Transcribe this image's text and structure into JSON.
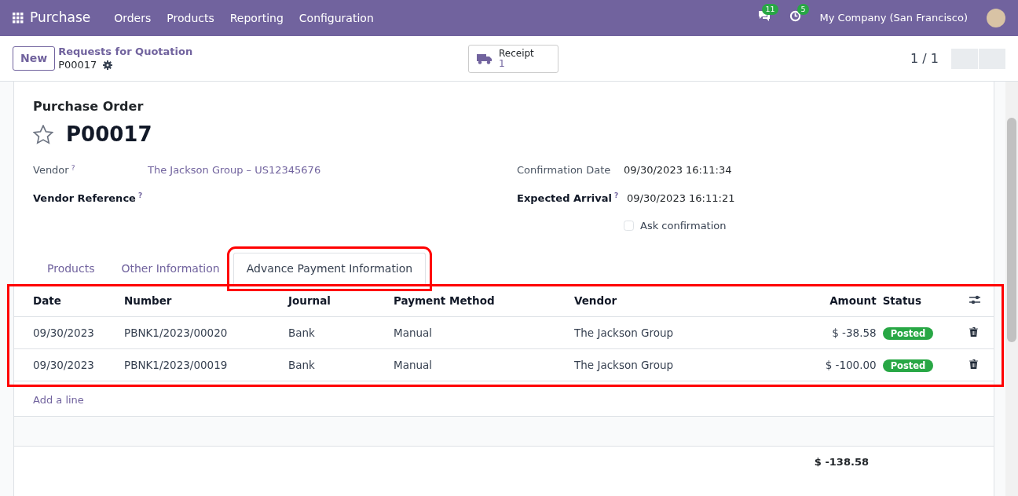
{
  "navbar": {
    "app": "Purchase",
    "menu": [
      "Orders",
      "Products",
      "Reporting",
      "Configuration"
    ],
    "messages_count": "11",
    "activities_count": "5",
    "company": "My Company (San Francisco)"
  },
  "control_panel": {
    "new_button": "New",
    "breadcrumb": "Requests for Quotation",
    "record": "P00017",
    "smart_button": {
      "label": "Receipt",
      "count": "1"
    },
    "pager": "1 / 1"
  },
  "form": {
    "caption": "Purchase Order",
    "starred": false,
    "name": "P00017",
    "left_fields": [
      {
        "label": "Vendor",
        "bold": false,
        "help": "?",
        "value": "The Jackson Group – US12345676",
        "link": true
      },
      {
        "label": "Vendor Reference",
        "bold": true,
        "help": "?"
      }
    ],
    "right_fields": [
      {
        "label": "Confirmation Date",
        "bold": false,
        "value": "09/30/2023 16:11:34"
      },
      {
        "label": "Expected Arrival",
        "bold": true,
        "help": "?",
        "value": "09/30/2023 16:11:21"
      }
    ],
    "ask_confirmation": {
      "label": "Ask confirmation",
      "checked": false
    }
  },
  "tabs": [
    {
      "label": "Products",
      "selected": false,
      "highlighted": false
    },
    {
      "label": "Other Information",
      "selected": false,
      "highlighted": false
    },
    {
      "label": "Advance Payment Information",
      "selected": true,
      "highlighted": true
    }
  ],
  "table": {
    "highlighted": true,
    "columns": [
      "Date",
      "Number",
      "Journal",
      "Payment Method",
      "Vendor",
      "Amount",
      "Status"
    ],
    "rows": [
      {
        "date": "09/30/2023",
        "number": "PBNK1/2023/00020",
        "journal": "Bank",
        "method": "Manual",
        "vendor": "The Jackson Group",
        "amount": "$ -38.58",
        "status": "Posted"
      },
      {
        "date": "09/30/2023",
        "number": "PBNK1/2023/00019",
        "journal": "Bank",
        "method": "Manual",
        "vendor": "The Jackson Group",
        "amount": "$ -100.00",
        "status": "Posted"
      }
    ],
    "add_line": "Add a line",
    "total": "$ -138.58"
  }
}
